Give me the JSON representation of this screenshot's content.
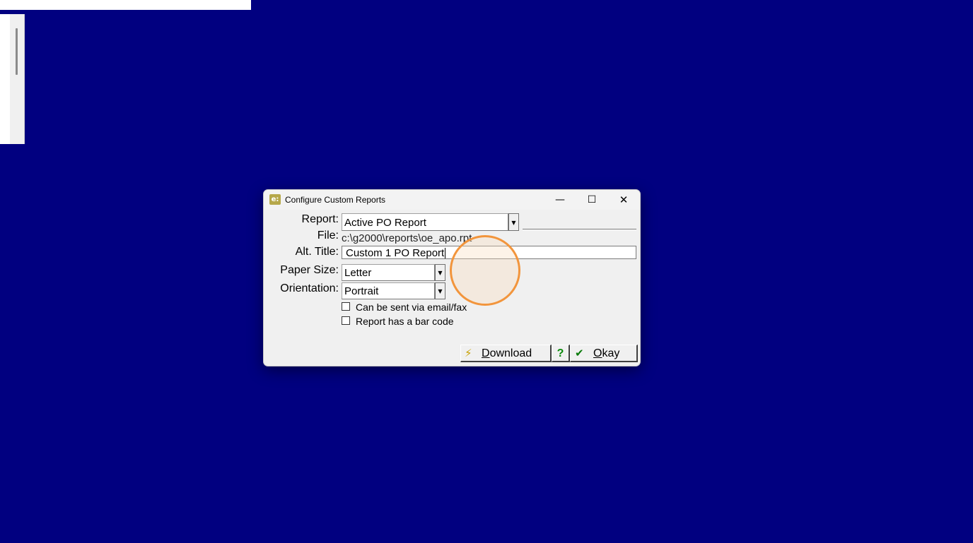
{
  "window": {
    "title": "Configure Custom Reports",
    "app_icon": "app-icon",
    "icon_text": "e:"
  },
  "form": {
    "report_label": "Report:",
    "report_value": "Active PO Report",
    "file_label": "File:",
    "file_value": "c:\\g2000\\reports\\oe_apo.rpt",
    "alt_title_label": "Alt. Title:",
    "alt_title_value": "Custom 1 PO Report",
    "paper_size_label": "Paper Size:",
    "paper_size_value": "Letter",
    "orientation_label": "Orientation:",
    "orientation_value": "Portrait",
    "email_fax_label": "Can be sent via email/fax",
    "email_fax_checked": false,
    "bar_code_label": "Report  has a bar code",
    "bar_code_checked": false
  },
  "buttons": {
    "download_label": "Download",
    "download_icon": "lightning-icon",
    "help_label": "?",
    "okay_label": "Okay",
    "okay_icon": "checkmark-icon"
  },
  "colors": {
    "desktop": "#010080",
    "dialog_bg": "#f0f0f0",
    "cursor_ring": "#f2953c",
    "help_green": "#0a8a0a"
  }
}
